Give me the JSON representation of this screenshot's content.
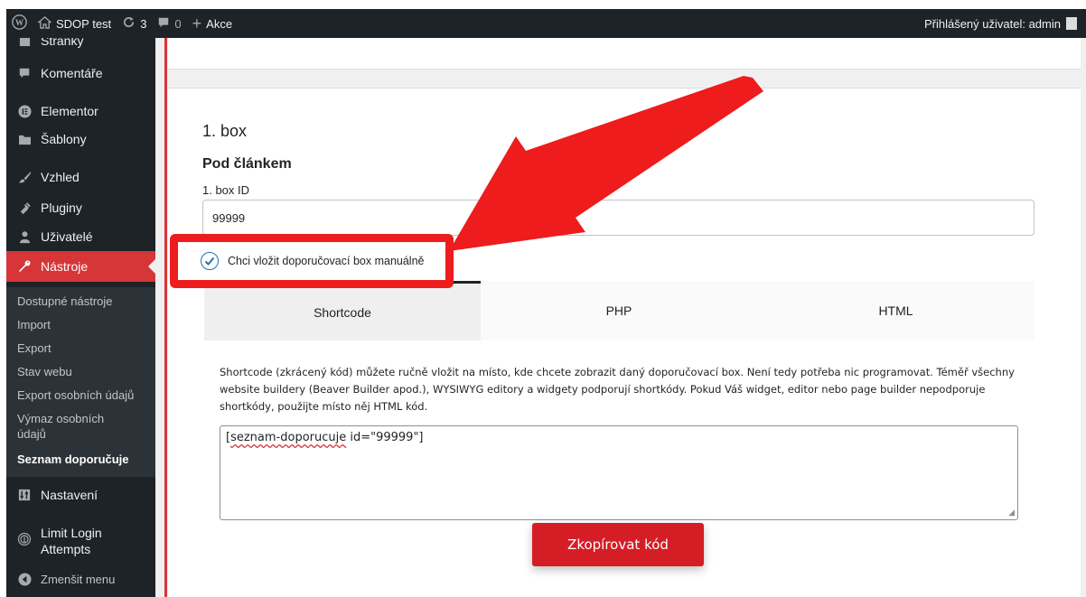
{
  "adminbar": {
    "site_name": "SDOP test",
    "updates_count": "3",
    "comments_count": "0",
    "new_label": "Akce",
    "user_greeting": "Přihlášený uživatel: admin"
  },
  "sidebar": {
    "items": [
      {
        "label": "Stránky",
        "icon": "page-icon"
      },
      {
        "label": "Komentáře",
        "icon": "comment-icon"
      },
      {
        "label": "Elementor",
        "icon": "elementor-icon"
      },
      {
        "label": "Šablony",
        "icon": "folder-icon"
      },
      {
        "label": "Vzhled",
        "icon": "brush-icon"
      },
      {
        "label": "Pluginy",
        "icon": "plugin-icon"
      },
      {
        "label": "Uživatelé",
        "icon": "users-icon"
      },
      {
        "label": "Nástroje",
        "icon": "wrench-icon"
      },
      {
        "label": "Nastavení",
        "icon": "settings-icon"
      },
      {
        "label": "Limit Login Attempts",
        "icon": "fingerprint-icon"
      },
      {
        "label": "Zmenšit menu",
        "icon": "collapse-icon"
      }
    ],
    "submenu": [
      "Dostupné nástroje",
      "Import",
      "Export",
      "Stav webu",
      "Export osobních údajů",
      "Výmaz osobních údajů",
      "Seznam doporučuje"
    ],
    "active_color": "#d63638"
  },
  "main": {
    "section_title": "1. box",
    "subsection_title": "Pod článkem",
    "id_label": "1. box ID",
    "id_value": "99999",
    "checkbox_label": "Chci vložit doporučovací box manuálně",
    "checkbox_checked": true,
    "tabs": [
      "Shortcode",
      "PHP",
      "HTML"
    ],
    "active_tab": "Shortcode",
    "description": "Shortcode (zkrácený kód) můžete ručně vložit na místo, kde chcete zobrazit daný doporučovací box. Není tedy potřeba nic programovat. Téměř všechny website buildery (Beaver Builder apod.), WYSIWYG editory a widgety podporují shortkódy. Pokud Váš widget, editor nebo page builder nepodporuje shortkódy, použijte místo něj HTML kód.",
    "code_prefix": "[",
    "code_underlined": "seznam-doporucuje",
    "code_suffix": " id=\"99999\"]",
    "copy_button": "Zkopírovat kód",
    "accent_color": "#d51d25",
    "annotation_color": "#ee1c1c"
  }
}
